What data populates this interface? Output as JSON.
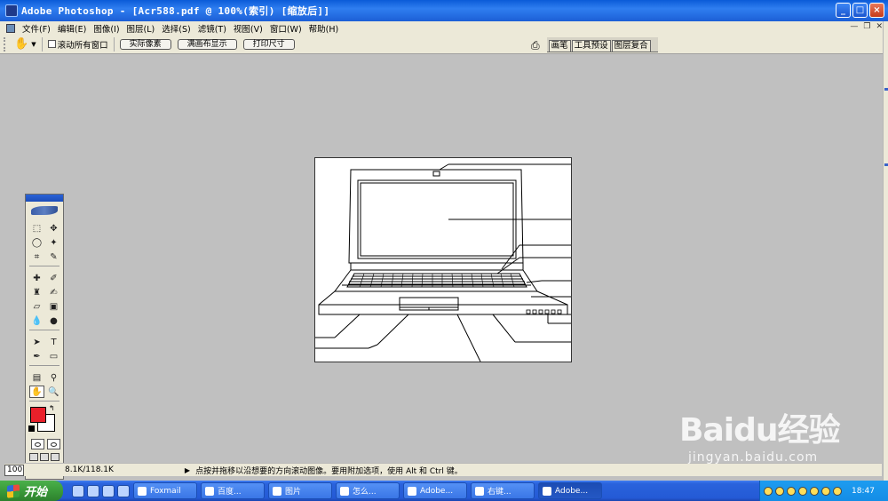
{
  "window": {
    "title": "Adobe Photoshop - [Acr588.pdf @ 100%(索引) [缩放后]]"
  },
  "window_controls": {
    "minimize": "_",
    "maximize": "□",
    "close": "×"
  },
  "menu": [
    "文件(F)",
    "编辑(E)",
    "图像(I)",
    "图层(L)",
    "选择(S)",
    "滤镜(T)",
    "视图(V)",
    "窗口(W)",
    "帮助(H)"
  ],
  "options": {
    "scroll_all_label": "滚动所有窗口",
    "buttons": [
      "实际像素",
      "满画布显示",
      "打印尺寸"
    ]
  },
  "palette_tabs": [
    "画笔",
    "工具预设",
    "图层复合"
  ],
  "toolbox": {
    "foreground_color": "#e9202a",
    "background_color": "#ffffff"
  },
  "status": {
    "zoom": "100",
    "doc_size": "8.1K/118.1K",
    "message": "点按并拖移以沿想要的方向滚动图像。要用附加选项，使用 Alt 和 Ctrl 键。"
  },
  "taskbar": {
    "start_label": "开始",
    "tasks": [
      "Foxmail",
      "百度...",
      "图片",
      "怎么...",
      "Adobe...",
      "右键...",
      "Adobe..."
    ],
    "active_task": 6,
    "clock": "18:47"
  },
  "watermark": {
    "main": "Baidu经验",
    "sub": "jingyan.baidu.com"
  }
}
